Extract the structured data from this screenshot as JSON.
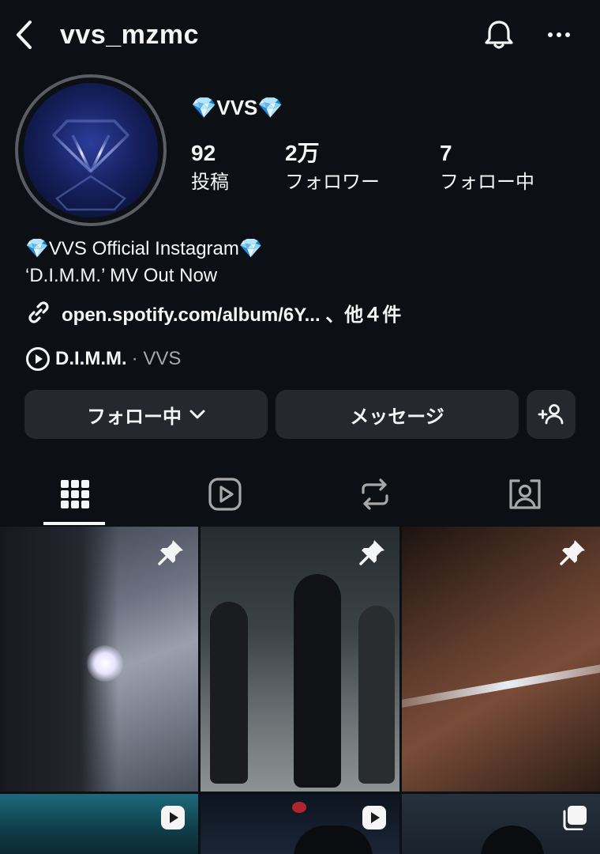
{
  "header": {
    "username": "vvs_mzmc",
    "back_icon": "chevron-left-icon",
    "bell_icon": "bell-icon",
    "more_icon": "more-horizontal-icon"
  },
  "profile": {
    "display_name": "💎VVS💎",
    "stats": [
      {
        "value": "92",
        "label": "投稿"
      },
      {
        "value": "2万",
        "label": "フォロワー"
      },
      {
        "value": "7",
        "label": "フォロー中"
      }
    ],
    "bio": [
      "💎VVS Official Instagram💎",
      "‘D.I.M.M.’ MV Out Now"
    ],
    "link": "open.spotify.com/album/6Y... 、他４件",
    "music": {
      "title": "D.I.M.M.",
      "artist": "· VVS"
    }
  },
  "actions": {
    "following_label": "フォロー中",
    "message_label": "メッセージ"
  },
  "tabs": [
    "grid-icon",
    "reels-icon",
    "reposts-icon",
    "tagged-icon"
  ],
  "posts": [
    {
      "type": "pinned"
    },
    {
      "type": "pinned"
    },
    {
      "type": "pinned"
    },
    {
      "type": "reel"
    },
    {
      "type": "reel"
    },
    {
      "type": "carousel"
    }
  ],
  "colors": {
    "background": "#0c1014",
    "button": "#25292e",
    "muted_text": "#a8a8a8",
    "text": "#f5f5f5"
  }
}
